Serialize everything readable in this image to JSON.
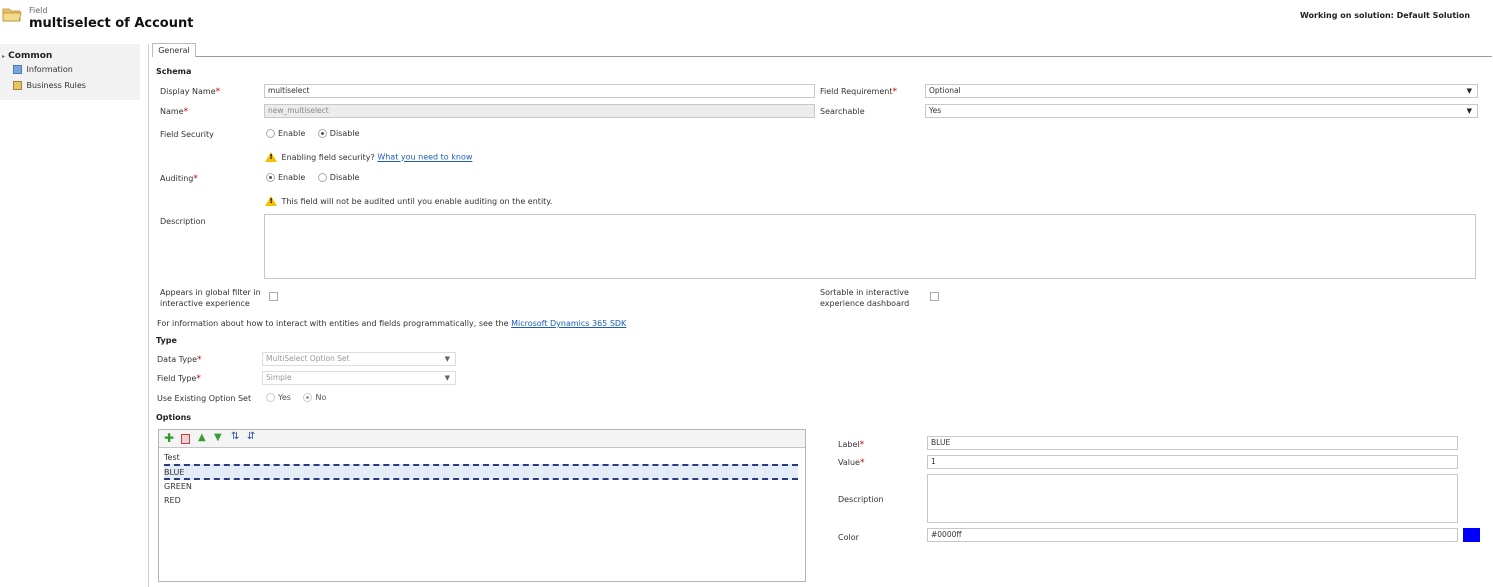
{
  "header": {
    "entity_type": "Field",
    "title": "multiselect of Account",
    "solution": "Working on solution: Default Solution"
  },
  "sidebar": {
    "group": "Common",
    "items": [
      {
        "label": "Information",
        "icon": "information-icon"
      },
      {
        "label": "Business Rules",
        "icon": "business-rules-icon"
      }
    ]
  },
  "tabs": [
    {
      "label": "General"
    }
  ],
  "schema": {
    "heading": "Schema",
    "display_name_label": "Display Name",
    "display_name_value": "multiselect",
    "name_label": "Name",
    "name_value": "new_multiselect",
    "field_security_label": "Field Security",
    "field_security_opts": [
      "Enable",
      "Disable"
    ],
    "field_security_selected": "Disable",
    "security_warning": "Enabling field security?",
    "security_link": "What you need to know",
    "auditing_label": "Auditing",
    "auditing_opts": [
      "Enable",
      "Disable"
    ],
    "auditing_selected": "Enable",
    "audit_warning": "This field will not be audited until you enable auditing on the entity.",
    "description_label": "Description",
    "description_value": "",
    "field_requirement_label": "Field Requirement",
    "field_requirement_value": "Optional",
    "searchable_label": "Searchable",
    "searchable_value": "Yes",
    "global_filter_label_1": "Appears in global filter in",
    "global_filter_label_2": "interactive experience",
    "sortable_label_1": "Sortable in interactive",
    "sortable_label_2": "experience dashboard",
    "sdk_text": "For information about how to interact with entities and fields programmatically, see the",
    "sdk_link": "Microsoft Dynamics 365 SDK"
  },
  "type": {
    "heading": "Type",
    "data_type_label": "Data Type",
    "data_type_value": "MultiSelect Option Set",
    "field_type_label": "Field Type",
    "field_type_value": "Simple",
    "use_existing_label": "Use Existing Option Set",
    "use_existing_opts": [
      "Yes",
      "No"
    ],
    "use_existing_selected": "No"
  },
  "options": {
    "heading": "Options",
    "toolbar": [
      "add-icon",
      "delete-icon",
      "move-up-icon",
      "move-down-icon",
      "sort-ascending-icon",
      "sort-descending-icon"
    ],
    "items": [
      "Test",
      "BLUE",
      "GREEN",
      "RED"
    ],
    "selected": "BLUE",
    "label_label": "Label",
    "label_value": "BLUE",
    "value_label": "Value",
    "value_value": "1",
    "description_label": "Description",
    "description_value": "",
    "color_label": "Color",
    "color_value": "#0000ff",
    "swatch_color": "#0000ff"
  }
}
